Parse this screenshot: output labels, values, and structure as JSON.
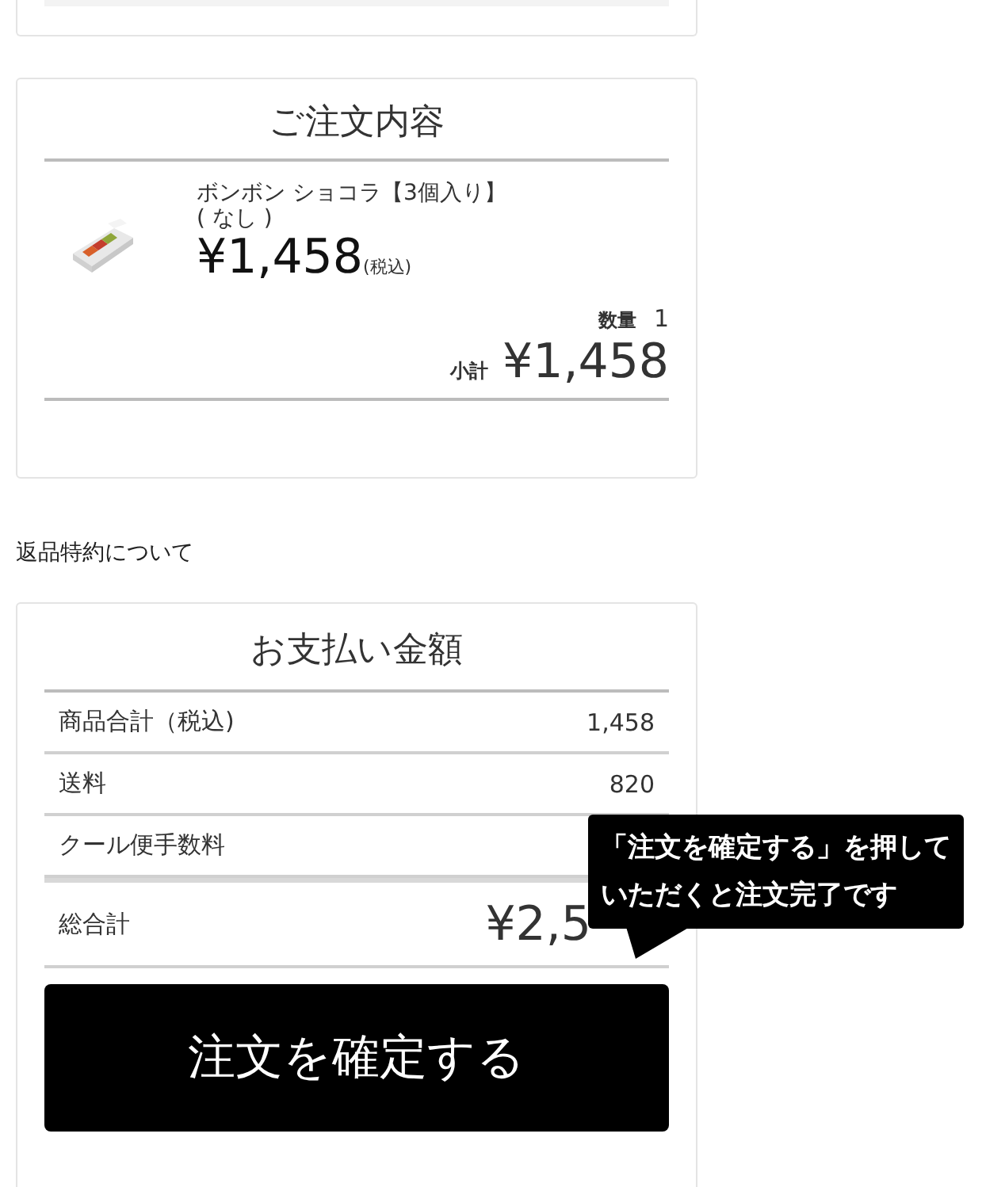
{
  "order": {
    "title": "ご注文内容",
    "item": {
      "kind": "picture",
      "name": "ボンボン ショコラ【3個入り】",
      "option": "( なし )",
      "price": "¥1,458",
      "tax_note": "(税込)",
      "quantity_label": "数量",
      "quantity": "1",
      "subtotal_label": "小計",
      "subtotal": "¥1,458"
    }
  },
  "returns_link": "返品特約について",
  "payment": {
    "title": "お支払い金額",
    "rows": [
      {
        "label": "商品合計（税込)",
        "value": "1,458"
      },
      {
        "label": "送料",
        "value": "820"
      },
      {
        "label": "クール便手数料"
      }
    ],
    "total_label": "総合計",
    "total": "¥2,5"
  },
  "confirm_button": "注文を確定する",
  "tooltip": "「注文を確定する」を押していただくと注文完了です"
}
